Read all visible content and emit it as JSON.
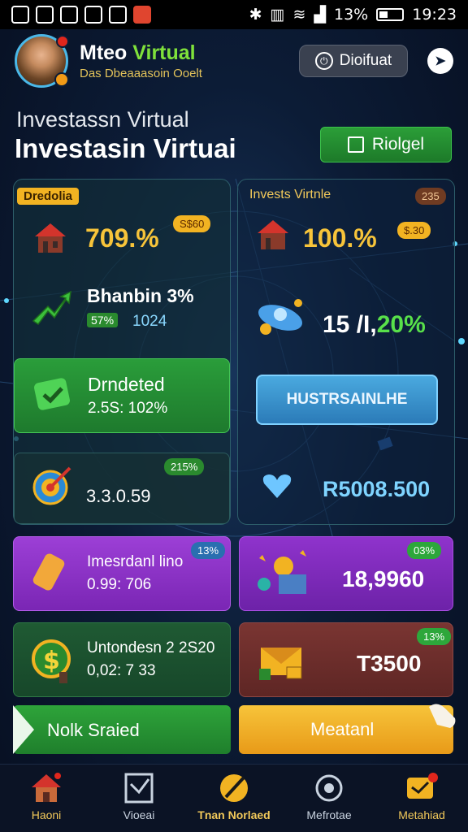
{
  "status_bar": {
    "time": "19:23",
    "battery": "13%"
  },
  "header": {
    "user_name_a": "Mteo",
    "user_name_b": "Virtual",
    "user_sub": "Das Dbeaaasoin Ooelt",
    "button_label": "Dioifuat"
  },
  "title": {
    "subtitle": "Investassn Virtual",
    "main": "Investasin Virtuai",
    "action_label": "Riolgel"
  },
  "left_panel": {
    "tag": "Dredolia",
    "row1": {
      "value": "709.%",
      "badge": "S$60"
    },
    "row2": {
      "title": "Bhanbin 3%",
      "badge": "57%",
      "sub": "1024"
    },
    "row3": {
      "title": "Drndeted",
      "sub": "2.5S: 102%"
    },
    "row4": {
      "badge": "215%",
      "value": "3.3.0.59"
    }
  },
  "right_panel": {
    "title": "Invests Virtnle",
    "badge": "235",
    "row1": {
      "value": "100.%",
      "badge": "$.30"
    },
    "row2": {
      "value_a": "15 /I,",
      "value_b": "20%"
    },
    "button_label": "HUSTRSAINLHE",
    "row4": {
      "value": "R5008.500"
    }
  },
  "purple_left": {
    "badge": "13%",
    "title": "Imesrdanl lino",
    "sub": "0.99: 706"
  },
  "purple_right": {
    "badge": "03%",
    "value": "18,9960"
  },
  "green_left": {
    "title": "Untondesn 2 2S20",
    "sub": "0,02: 7 33"
  },
  "brown_right": {
    "badge": "13%",
    "value": "T3500"
  },
  "buttons": {
    "left": "Nolk Sraied",
    "right": "Meatanl"
  },
  "bottom_nav": [
    {
      "label": "Haoni"
    },
    {
      "label": "Vioeai"
    },
    {
      "label": "Tnan Norlaed"
    },
    {
      "label": "Mefrotae"
    },
    {
      "label": "Metahiad"
    }
  ],
  "colors": {
    "accent_yellow": "#f7c43a",
    "accent_green": "#2b9e38",
    "purple": "#8a2fc7",
    "brown": "#6b2f2a"
  }
}
